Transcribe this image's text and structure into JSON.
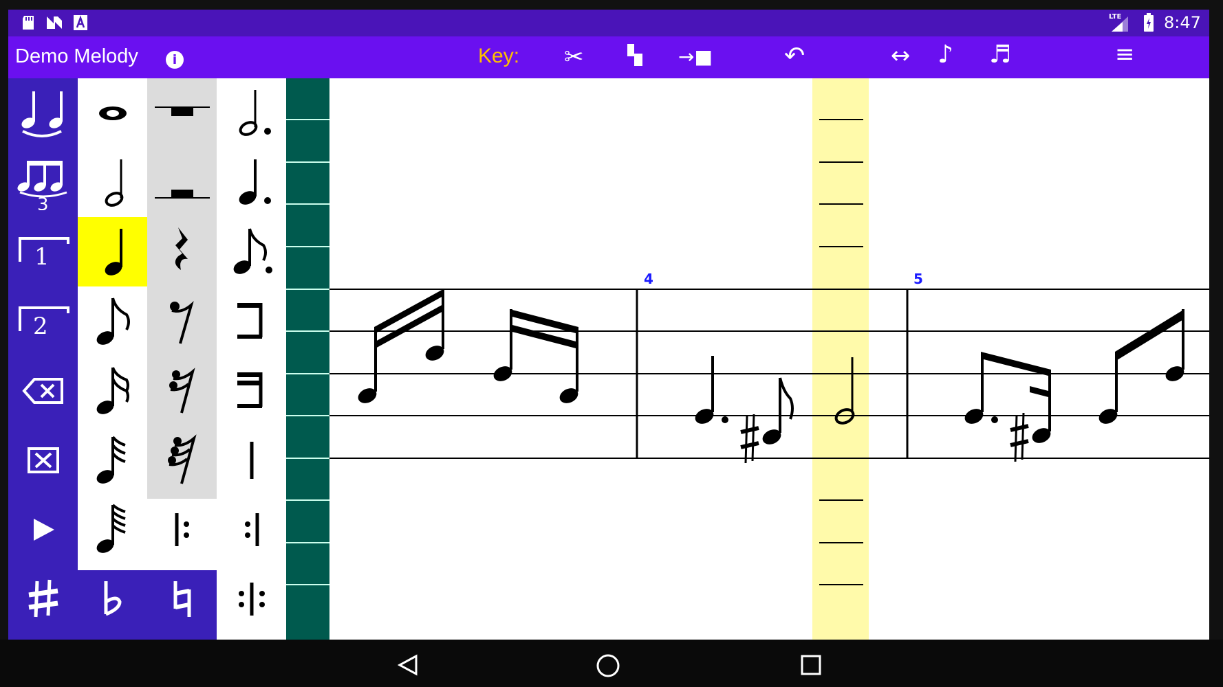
{
  "status": {
    "time": "8:47",
    "network": "LTE",
    "left_icons": [
      "sd-card-icon",
      "n-icon",
      "a-icon"
    ],
    "right_icons": [
      "signal-icon",
      "battery-icon"
    ]
  },
  "app": {
    "title": "Demo Melody",
    "info_glyph": "i",
    "key_label": "Key:",
    "toolbar": [
      {
        "name": "cut-icon",
        "glyph": "✂"
      },
      {
        "name": "split-icon",
        "glyph": "▚"
      },
      {
        "name": "jump-to-end-icon",
        "glyph": "→■"
      },
      {
        "name": "undo-icon",
        "glyph": "↶"
      },
      {
        "name": "spacing-icon",
        "glyph": "↔"
      },
      {
        "name": "note-play-icon",
        "glyph": "♪"
      },
      {
        "name": "notes-icon",
        "glyph": "♬"
      }
    ],
    "menu_glyph": "≡"
  },
  "sidebar": {
    "tie_label": "♩♩",
    "triplet_number": "3",
    "ending1_number": "1",
    "ending2_number": "2",
    "delete_glyph": "⌫",
    "clear_glyph": "⊠",
    "play_glyph": "▶"
  },
  "palette": {
    "notes": [
      "𝅝",
      "𝅗𝅥",
      "♩",
      "♪",
      "𝅘𝅥𝅯",
      "𝅘𝅥𝅰",
      "𝅘𝅥𝅱"
    ],
    "rests": [
      "▬",
      "▬",
      "𝄽",
      "𝄾",
      "𝄿",
      "𝅀"
    ],
    "dotted": [
      "𝅗𝅥.",
      "♩.",
      "♪."
    ],
    "accidentals": {
      "sharp": "♯",
      "flat": "♭",
      "natural": "♮"
    },
    "repeat_start": "𝄆",
    "repeat_end": "𝄇",
    "repeat_both": ":|:",
    "barline": "|",
    "selected": "quarter-note",
    "highlight_color": "#ffff00"
  },
  "score": {
    "measure_numbers": [
      "4",
      "5"
    ],
    "cursor_color": "#fffaaa",
    "measure_number_color": "#1a1aff"
  },
  "colors": {
    "statusbar": "#4a14b8",
    "appbar": "#6a10f0",
    "sidebar": "#3a20b8",
    "key_label": "#ffc000",
    "teal": "#005a4e"
  }
}
